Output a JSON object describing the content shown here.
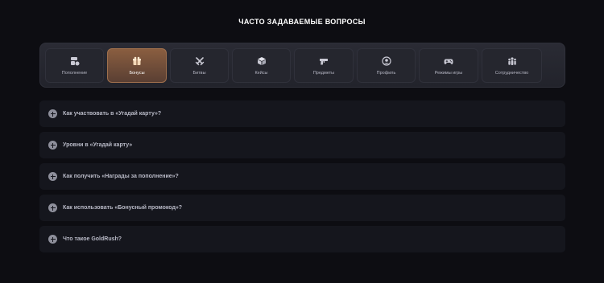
{
  "page": {
    "title": "ЧАСТО ЗАДАВАЕМЫЕ ВОПРОСЫ"
  },
  "tabs": [
    {
      "label": "Пополнение",
      "icon": "deposit-icon",
      "active": false
    },
    {
      "label": "Бонусы",
      "icon": "gift-icon",
      "active": true
    },
    {
      "label": "Битвы",
      "icon": "crossed-swords-icon",
      "active": false
    },
    {
      "label": "Кейсы",
      "icon": "case-box-icon",
      "active": false
    },
    {
      "label": "Предметы",
      "icon": "gun-icon",
      "active": false
    },
    {
      "label": "Профиль",
      "icon": "profile-icon",
      "active": false
    },
    {
      "label": "Режимы игры",
      "icon": "gamepad-icon",
      "active": false
    },
    {
      "label": "Сотрудничество",
      "icon": "team-icon",
      "active": false
    }
  ],
  "faq": [
    {
      "question": "Как участвовать в «Угадай карту»?"
    },
    {
      "question": "Уровни в «Угадай карту»"
    },
    {
      "question": "Как получить «Награды за пополнение»?"
    },
    {
      "question": "Как использовать «Бонусный промокод»?"
    },
    {
      "question": "Что такое GoldRush?"
    }
  ],
  "colors": {
    "background": "#0d0d12",
    "panel": "#22232b",
    "accent": "#a0704d",
    "item": "#15161d"
  }
}
